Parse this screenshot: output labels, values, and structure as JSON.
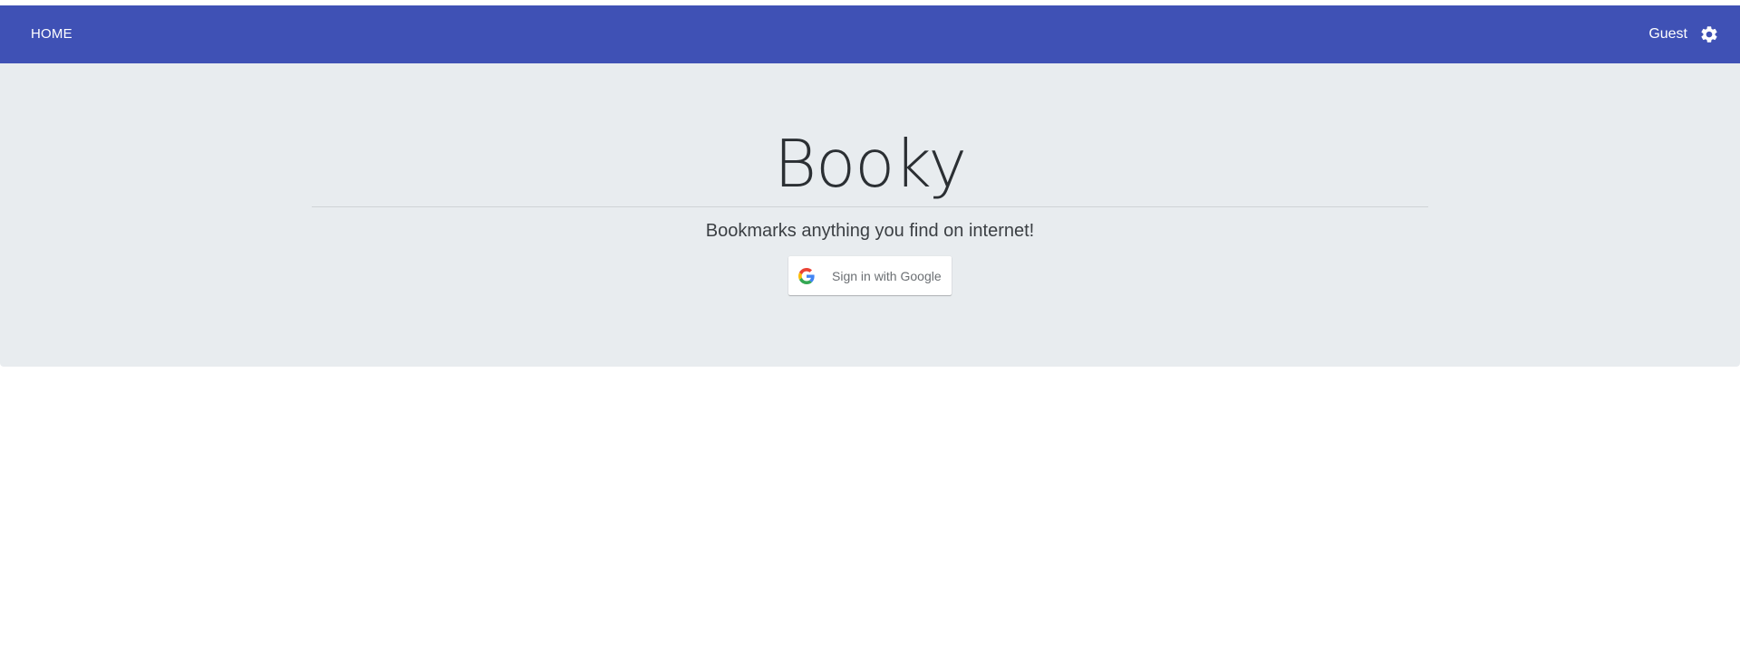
{
  "nav": {
    "home_label": "HOME",
    "user_label": "Guest",
    "settings_icon": "gear-icon"
  },
  "hero": {
    "title": "Booky",
    "subtitle": "Bookmarks anything you find on internet!",
    "signin_label": "Sign in with Google",
    "signin_icon": "google-logo-icon"
  },
  "colors": {
    "header": "#3f51b5",
    "hero_bg": "#e8ecef",
    "text": "#2b2f33"
  }
}
